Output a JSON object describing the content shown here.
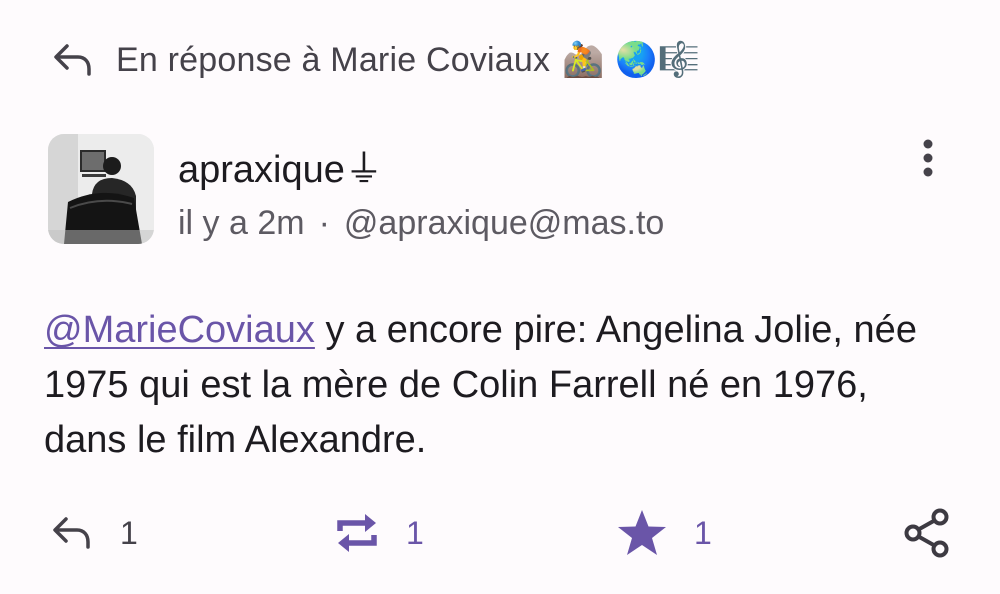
{
  "reply_context": {
    "text": "En réponse à Marie Coviaux",
    "emojis": "🚵 🌏🎼"
  },
  "status": {
    "author": {
      "display_name": "apraxique",
      "name_glyph": "⏚",
      "time_ago": "il y a 2m",
      "separator": "·",
      "handle": "@apraxique@mas.to"
    },
    "content": {
      "mention": "@MarieCoviaux",
      "text": " y a encore pire: Angelina Jolie, née 1975 qui est la mère de Colin Farrell né en 1976, dans le film Alexandre."
    },
    "actions": {
      "replies": "1",
      "boosts": "1",
      "favourites": "1"
    }
  },
  "colors": {
    "accent": "#6a55a8",
    "text": "#1d1b20",
    "secondary_text": "#5d5a62",
    "background": "#fefbfd"
  },
  "icons": {
    "reply": "reply-arrow-icon",
    "more": "more-vertical-icon",
    "boost": "repeat-icon",
    "favourite": "star-icon",
    "share": "share-icon"
  }
}
